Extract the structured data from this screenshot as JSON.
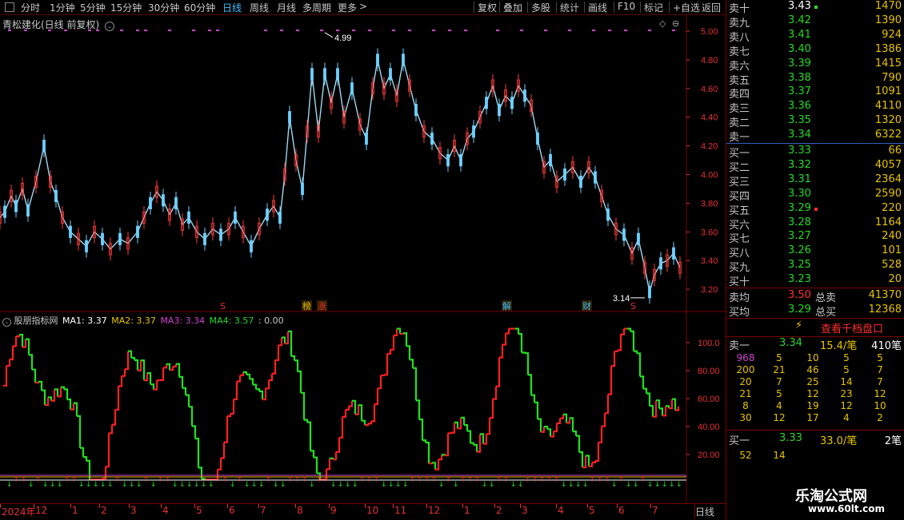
{
  "toolbar": {
    "periods": [
      "分时",
      "1分钟",
      "5分钟",
      "15分钟",
      "30分钟",
      "60分钟",
      "日线",
      "周线",
      "月线",
      "多周期",
      "更多"
    ],
    "active_period": "日线",
    "more_arrow": ">",
    "actions": [
      "复权",
      "叠加",
      "多股",
      "统计",
      "画线",
      "F10",
      "标记",
      "+自选",
      "返回"
    ]
  },
  "main": {
    "title": "青松建化(日线 前复权)",
    "price_axis": [
      "5.00",
      "4.80",
      "4.60",
      "4.40",
      "4.20",
      "4.00",
      "3.80",
      "3.60",
      "3.40",
      "3.20"
    ],
    "high_label": "4.99",
    "low_label": "3.14",
    "markers": [
      {
        "text": "S",
        "color": "#e83030"
      },
      {
        "text": "榜",
        "color": "#e8c400"
      },
      {
        "text": "涨",
        "color": "#e83030"
      },
      {
        "text": "解",
        "color": "#3ec0ff"
      },
      {
        "text": "财",
        "color": "#3ec0ff"
      },
      {
        "text": "S",
        "color": "#e83030"
      }
    ]
  },
  "indicator": {
    "name": "股朋指标网",
    "ma1_label": "MA1: 3.37",
    "ma2_label": "MA2: 3.37",
    "ma3_label": "MA3: 3.34",
    "ma4_label": "MA4: 3.57",
    "extra": ": 0.00",
    "axis": [
      "100.0",
      "80.00",
      "60.00",
      "40.00",
      "20.00"
    ]
  },
  "date_axis": {
    "labels": [
      "2024年",
      "12",
      "1",
      "2",
      "3",
      "4",
      "5",
      "6",
      "7",
      "8",
      "9",
      "10",
      "11",
      "12",
      "1",
      "2",
      "3",
      "4",
      "5",
      "6",
      "7"
    ],
    "period_label": "日线"
  },
  "order_book": {
    "sells": [
      {
        "label": "卖十",
        "price": "3.43",
        "vol": "1470"
      },
      {
        "label": "卖九",
        "price": "3.42",
        "vol": "1390"
      },
      {
        "label": "卖八",
        "price": "3.41",
        "vol": "924"
      },
      {
        "label": "卖七",
        "price": "3.40",
        "vol": "1386"
      },
      {
        "label": "卖六",
        "price": "3.39",
        "vol": "1415"
      },
      {
        "label": "卖五",
        "price": "3.38",
        "vol": "790"
      },
      {
        "label": "卖四",
        "price": "3.37",
        "vol": "1091"
      },
      {
        "label": "卖三",
        "price": "3.36",
        "vol": "4110"
      },
      {
        "label": "卖二",
        "price": "3.35",
        "vol": "1320"
      },
      {
        "label": "卖一",
        "price": "3.34",
        "vol": "6322"
      }
    ],
    "buys": [
      {
        "label": "买一",
        "price": "3.33",
        "vol": "66"
      },
      {
        "label": "买二",
        "price": "3.32",
        "vol": "4057"
      },
      {
        "label": "买三",
        "price": "3.31",
        "vol": "2364"
      },
      {
        "label": "买四",
        "price": "3.30",
        "vol": "2590"
      },
      {
        "label": "买五",
        "price": "3.29",
        "vol": "220"
      },
      {
        "label": "买六",
        "price": "3.28",
        "vol": "1164"
      },
      {
        "label": "买七",
        "price": "3.27",
        "vol": "240"
      },
      {
        "label": "买八",
        "price": "3.26",
        "vol": "101"
      },
      {
        "label": "买九",
        "price": "3.25",
        "vol": "528"
      },
      {
        "label": "买十",
        "price": "3.23",
        "vol": "20"
      }
    ],
    "sell_avg_label": "卖均",
    "sell_avg": "3.50",
    "sell_total_label": "总卖",
    "sell_total": "41370",
    "buy_avg_label": "买均",
    "buy_avg": "3.29",
    "buy_total_label": "总买",
    "buy_total": "12368",
    "view_button": "查看千档盘口"
  },
  "tick_queue": {
    "sell_label": "卖一",
    "sell_price": "3.34",
    "sell_avg": "15.4/笔",
    "sell_count": "410笔",
    "sell_rows": [
      [
        "968",
        "5",
        "10",
        "5",
        "5"
      ],
      [
        "200",
        "21",
        "46",
        "5",
        "7"
      ],
      [
        "20",
        "7",
        "25",
        "14",
        "7"
      ],
      [
        "21",
        "5",
        "12",
        "23",
        "12"
      ],
      [
        "8",
        "4",
        "19",
        "12",
        "10"
      ],
      [
        "30",
        "12",
        "17",
        "4",
        "2"
      ]
    ],
    "buy_label": "买一",
    "buy_price": "3.33",
    "buy_avg": "33.0/笔",
    "buy_count": "2笔",
    "buy_rows": [
      [
        "52",
        "14"
      ]
    ]
  },
  "watermark": {
    "title": "乐淘公式网",
    "url": "www.60lt.com"
  }
}
